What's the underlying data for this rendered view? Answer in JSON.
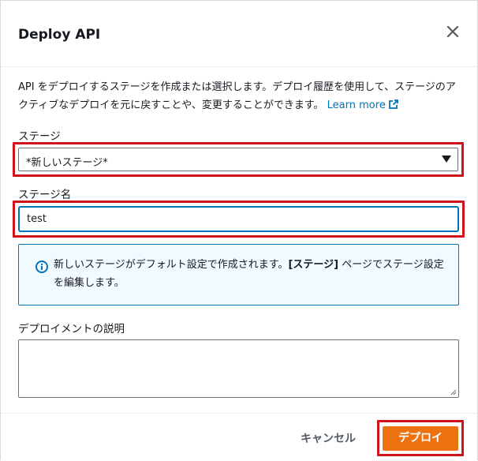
{
  "dialog": {
    "title": "Deploy API",
    "close_icon": "close-icon"
  },
  "description": {
    "text": "API をデプロイするステージを作成または選択します。デプロイ履歴を使用して、ステージのアクティブなデプロイを元に戻すことや、変更することができます。",
    "learn_more": "Learn more",
    "learn_more_icon": "external-link-icon"
  },
  "stage": {
    "label": "ステージ",
    "selected": "*新しいステージ*"
  },
  "stage_name": {
    "label": "ステージ名",
    "value": "test"
  },
  "info": {
    "icon": "info-icon",
    "text_before": "新しいステージがデフォルト設定で作成されます。",
    "text_bold": "[ステージ]",
    "text_after": " ページでステージ設定を編集します。"
  },
  "deploy_description": {
    "label": "デプロイメントの説明",
    "value": ""
  },
  "footer": {
    "cancel_label": "キャンセル",
    "deploy_label": "デプロイ"
  },
  "colors": {
    "highlight": "#d0121b",
    "primary_button": "#ec7211",
    "link": "#0073bb",
    "info_background": "#f1faff"
  }
}
